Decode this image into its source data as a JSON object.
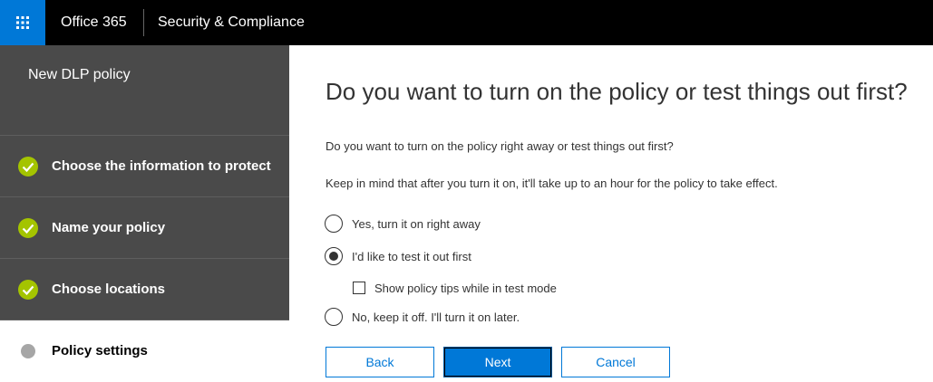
{
  "topbar": {
    "brand": "Office 365",
    "app_title": "Security & Compliance",
    "waffle_icon": "app-launcher-icon",
    "background": "#000000",
    "waffle_background": "#0078d7"
  },
  "sidebar": {
    "title": "New DLP policy",
    "steps": [
      {
        "label": "Choose the information to protect",
        "status": "completed"
      },
      {
        "label": "Name your policy",
        "status": "completed"
      },
      {
        "label": "Choose locations",
        "status": "completed"
      },
      {
        "label": "Policy settings",
        "status": "current"
      }
    ],
    "check_color": "#a4c400",
    "background": "#4a4a4a"
  },
  "main": {
    "heading": "Do you want to turn on the policy or test things out first?",
    "question": "Do you want to turn on the policy right away or test things out first?",
    "note": "Keep in mind that after you turn it on, it'll take up to an hour for the policy to take effect.",
    "options": [
      {
        "label": "Yes, turn it on right away",
        "checked": false
      },
      {
        "label": "I'd like to test it out first",
        "checked": true
      },
      {
        "label": "No, keep it off. I'll turn it on later.",
        "checked": false
      }
    ],
    "test_mode_option": {
      "label": "Show policy tips while in test mode",
      "checked": false
    }
  },
  "buttons": {
    "back": "Back",
    "next": "Next",
    "cancel": "Cancel",
    "accent": "#0078d7"
  }
}
